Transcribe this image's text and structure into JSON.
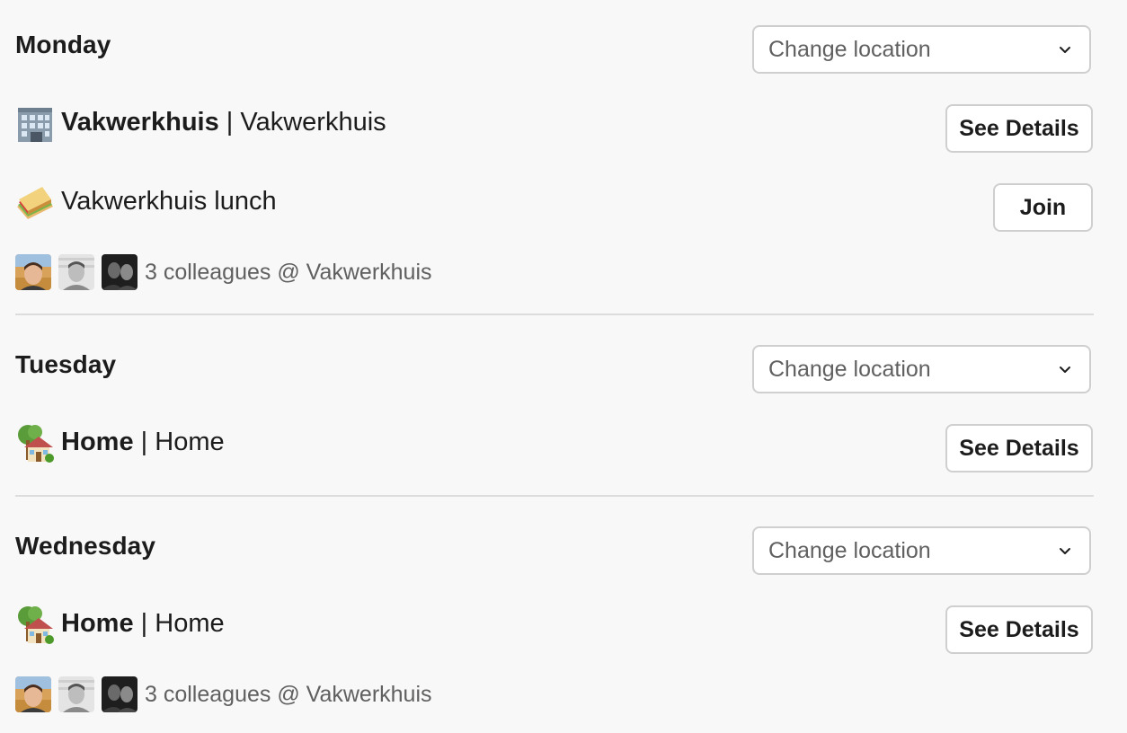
{
  "days": [
    {
      "title": "Monday",
      "select_label": "Change location",
      "location": {
        "name": "Vakwerkhuis",
        "sub": "Vakwerkhuis",
        "icon": "office-building-icon",
        "button": "See Details"
      },
      "event": {
        "name": "Vakwerkhuis lunch",
        "icon": "sandwich-icon",
        "button": "Join"
      },
      "colleagues": "3 colleagues @ Vakwerkhuis"
    },
    {
      "title": "Tuesday",
      "select_label": "Change location",
      "location": {
        "name": "Home",
        "sub": "Home",
        "icon": "house-with-garden-icon",
        "button": "See Details"
      }
    },
    {
      "title": "Wednesday",
      "select_label": "Change location",
      "location": {
        "name": "Home",
        "sub": "Home",
        "icon": "house-with-garden-icon",
        "button": "See Details"
      },
      "colleagues": "3 colleagues @ Vakwerkhuis"
    }
  ],
  "separator": "|",
  "colors": {
    "background": "#f8f8f8",
    "border": "#cfcfcf",
    "text": "#1d1c1d",
    "muted_text": "#616061",
    "divider": "#dcdcdc"
  }
}
